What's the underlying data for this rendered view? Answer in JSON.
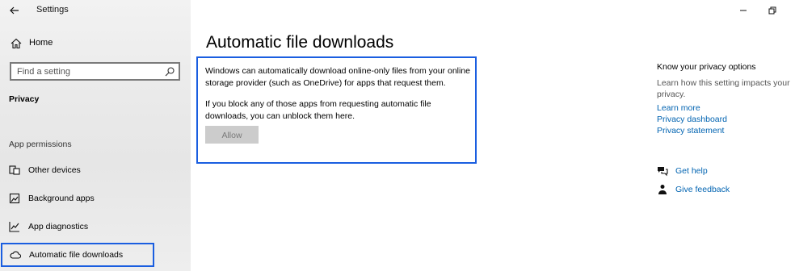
{
  "app": {
    "title": "Settings"
  },
  "sidebar": {
    "home_label": "Home",
    "search_placeholder": "Find a setting",
    "section_title": "Privacy",
    "group_label": "App permissions",
    "items": [
      {
        "label": "Other devices",
        "icon": "devices-icon"
      },
      {
        "label": "Background apps",
        "icon": "background-apps-icon"
      },
      {
        "label": "App diagnostics",
        "icon": "diagnostics-icon"
      },
      {
        "label": "Automatic file downloads",
        "icon": "cloud-icon",
        "active": true
      }
    ]
  },
  "main": {
    "title": "Automatic file downloads",
    "description1": "Windows can automatically download online-only files from your online storage provider (such as OneDrive) for apps that request them.",
    "description2": "If you block any of those apps from requesting automatic file downloads, you can unblock them here.",
    "allow_label": "Allow"
  },
  "right_panel": {
    "title": "Know your privacy options",
    "description": "Learn how this setting impacts your privacy.",
    "links": [
      "Learn more",
      "Privacy dashboard",
      "Privacy statement"
    ],
    "get_help": "Get help",
    "give_feedback": "Give feedback"
  },
  "colors": {
    "accent": "#0063b1",
    "highlight_border": "#1a5ee0",
    "sidebar_bg": "#e9e9e9"
  }
}
